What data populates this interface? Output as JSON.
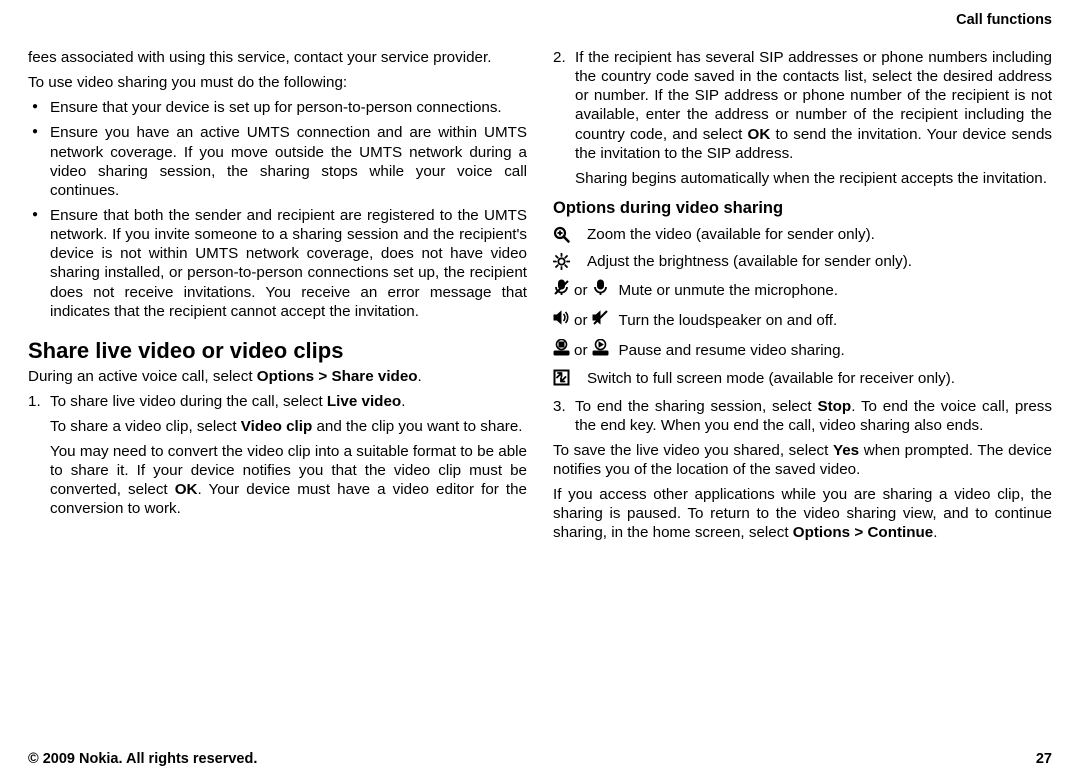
{
  "header": {
    "section": "Call functions"
  },
  "footer": {
    "copyright": "© 2009 Nokia. All rights reserved.",
    "page": "27"
  },
  "col1": {
    "intro1a": "fees associated with using this service, contact your service provider.",
    "intro1b": "To use video sharing you must do the following:",
    "bullets": [
      "Ensure that your device is set up for person-to-person connections.",
      "Ensure you have an active UMTS connection and are within UMTS network coverage. If you move outside the UMTS network during a video sharing session, the sharing stops while your voice call continues.",
      "Ensure that both the sender and recipient are registered to the UMTS network. If you invite someone to a sharing session and the recipient's device is not within UMTS network coverage, does not have video sharing installed, or person-to-person connections set up, the recipient does not receive invitations. You receive an error message that indicates that the recipient cannot accept the invitation."
    ],
    "h2": "Share live video or video clips",
    "p_after_h2_pre": "During an active voice call, select ",
    "p_after_h2_bold": "Options > Share video",
    "p_after_h2_post": ".",
    "step1_num": "1.",
    "step1_line1_pre": "To share live video during the call, select ",
    "step1_line1_bold": "Live video",
    "step1_line1_post": ".",
    "step1_line2_pre": "To share a video clip, select ",
    "step1_line2_bold": "Video clip",
    "step1_line2_post": " and the clip you want to share.",
    "step1_line3_pre": "You may need to convert the video clip into a suitable format to be able to share it. If your device notifies you that the video clip must be converted, select ",
    "step1_line3_bold": "OK",
    "step1_line3_post": ". Your device must have a video editor for the conversion to work."
  },
  "col2": {
    "step2_num": "2.",
    "step2_text_pre": "If the recipient has several SIP addresses or phone numbers including the country code saved in the contacts list, select the desired address or number. If the SIP address or phone number of the recipient is not available, enter the address or number of the recipient including the country code, and select ",
    "step2_text_bold": "OK",
    "step2_text_post": " to send the invitation. Your device sends the invitation to the SIP address.",
    "step2_sub": "Sharing begins automatically when the recipient accepts the invitation.",
    "h3": "Options during video sharing",
    "opts": {
      "zoom": "Zoom the video (available for sender only).",
      "bright": "Adjust the brightness (available for sender only).",
      "mute_or": "or",
      "mute": "Mute or unmute the microphone.",
      "speaker_or": "or",
      "speaker": "Turn the loudspeaker on and off.",
      "pause_or": "or",
      "pause": "Pause and resume video sharing.",
      "full": "Switch to full screen mode (available for receiver only)."
    },
    "step3_num": "3.",
    "step3_pre": "To end the sharing session, select ",
    "step3_bold": "Stop",
    "step3_post": ". To end the voice call, press the end key. When you end the call, video sharing also ends.",
    "p_save_pre": "To save the live video you shared, select ",
    "p_save_bold": "Yes",
    "p_save_post": " when prompted. The device notifies you of the location of the saved video.",
    "p_access_pre": "If you access other applications while you are sharing a video clip, the sharing is paused. To return to the video sharing view, and to continue sharing, in the home screen, select ",
    "p_access_bold": "Options > Continue",
    "p_access_post": "."
  }
}
